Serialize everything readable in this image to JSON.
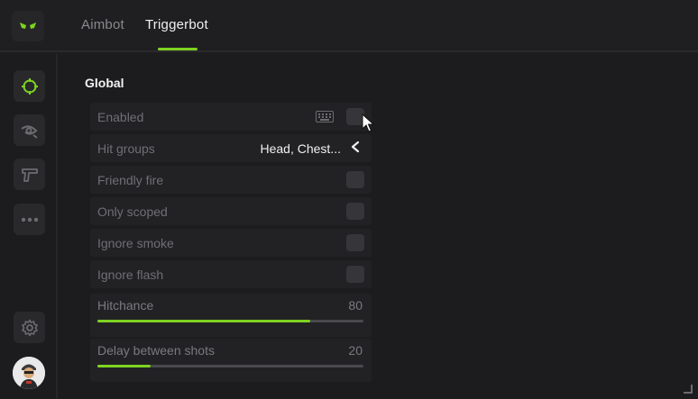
{
  "tabs": [
    {
      "label": "Aimbot",
      "active": false
    },
    {
      "label": "Triggerbot",
      "active": true
    }
  ],
  "colors": {
    "accent": "#7ed321",
    "background": "#1c1c1e",
    "row": "#222225"
  },
  "sidebar": {
    "items": [
      {
        "icon": "crosshair-icon",
        "active": true
      },
      {
        "icon": "eye-icon",
        "active": false
      },
      {
        "icon": "pistol-icon",
        "active": false
      },
      {
        "icon": "more-icon",
        "active": false
      }
    ],
    "settings_icon": "gear-icon",
    "avatar_icon": "avatar-character-icon"
  },
  "section": {
    "title": "Global",
    "options": [
      {
        "label": "Enabled",
        "type": "checkbox",
        "checked": false,
        "has_keybind": true
      },
      {
        "label": "Hit groups",
        "type": "select",
        "value": "Head, Chest..."
      },
      {
        "label": "Friendly fire",
        "type": "checkbox",
        "checked": false
      },
      {
        "label": "Only scoped",
        "type": "checkbox",
        "checked": false
      },
      {
        "label": "Ignore smoke",
        "type": "checkbox",
        "checked": false
      },
      {
        "label": "Ignore flash",
        "type": "checkbox",
        "checked": false
      }
    ],
    "sliders": [
      {
        "label": "Hitchance",
        "value": "80",
        "fill_fraction": 0.8
      },
      {
        "label": "Delay between shots",
        "value": "20",
        "fill_fraction": 0.2
      }
    ]
  }
}
